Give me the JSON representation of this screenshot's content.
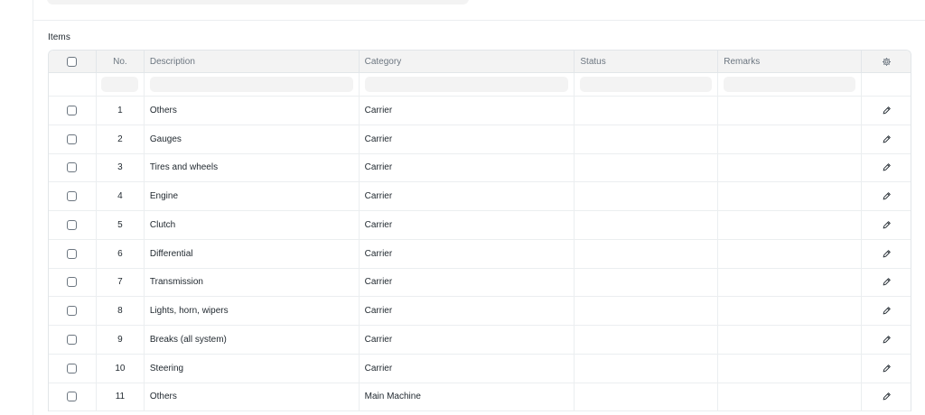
{
  "section": {
    "label": "Items"
  },
  "table": {
    "headers": {
      "no": "No.",
      "description": "Description",
      "category": "Category",
      "status": "Status",
      "remarks": "Remarks"
    },
    "settings_icon": "gear-icon",
    "edit_icon": "pencil-icon",
    "rows": [
      {
        "no": "1",
        "description": "Others",
        "category": "Carrier",
        "status": "",
        "remarks": ""
      },
      {
        "no": "2",
        "description": "Gauges",
        "category": "Carrier",
        "status": "",
        "remarks": ""
      },
      {
        "no": "3",
        "description": "Tires and wheels",
        "category": "Carrier",
        "status": "",
        "remarks": ""
      },
      {
        "no": "4",
        "description": "Engine",
        "category": "Carrier",
        "status": "",
        "remarks": ""
      },
      {
        "no": "5",
        "description": "Clutch",
        "category": "Carrier",
        "status": "",
        "remarks": ""
      },
      {
        "no": "6",
        "description": "Differential",
        "category": "Carrier",
        "status": "",
        "remarks": ""
      },
      {
        "no": "7",
        "description": "Transmission",
        "category": "Carrier",
        "status": "",
        "remarks": ""
      },
      {
        "no": "8",
        "description": "Lights, horn, wipers",
        "category": "Carrier",
        "status": "",
        "remarks": ""
      },
      {
        "no": "9",
        "description": "Breaks (all system)",
        "category": "Carrier",
        "status": "",
        "remarks": ""
      },
      {
        "no": "10",
        "description": "Steering",
        "category": "Carrier",
        "status": "",
        "remarks": ""
      },
      {
        "no": "11",
        "description": "Others",
        "category": "Main Machine",
        "status": "",
        "remarks": ""
      }
    ]
  }
}
